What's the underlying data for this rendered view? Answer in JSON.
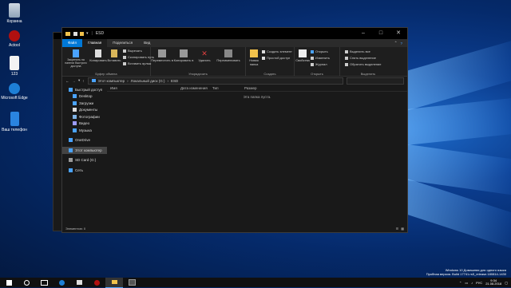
{
  "desktop": {
    "icons": [
      {
        "label": "Корзина"
      },
      {
        "label": "Actool"
      },
      {
        "label": "123"
      },
      {
        "label": "Microsoft Edge"
      },
      {
        "label": "Ваш телефон"
      }
    ]
  },
  "window": {
    "title": "ESD",
    "title_back": "Локальный диск (G:)",
    "tabs": [
      {
        "label": "Файл"
      },
      {
        "label": "Главная"
      },
      {
        "label": "Поделиться"
      },
      {
        "label": "Вид"
      }
    ],
    "ribbon": {
      "pin_label": "Закрепить на панели быстрого доступа",
      "copy_label": "Копировать",
      "paste_label": "Вставить",
      "cut_label": "Вырезать",
      "copy_path_label": "Скопировать путь",
      "paste_shortcut_label": "Вставить ярлык",
      "clipboard_group": "Буфер обмена",
      "move_to_label": "Переместить в",
      "copy_to_label": "Копировать в",
      "delete_label": "Удалить",
      "rename_label": "Переименовать",
      "organize_group": "Упорядочить",
      "new_folder_label": "Новая папка",
      "new_item_label": "Создать элемент",
      "easy_access_label": "Простой доступ",
      "create_group": "Создать",
      "properties_label": "Свойства",
      "open_label": "Открыть",
      "edit_label": "Изменить",
      "history_label": "Журнал",
      "open_group": "Открыть",
      "select_all_label": "Выделить все",
      "select_none_label": "Снять выделение",
      "invert_selection_label": "Обратить выделение",
      "select_group": "Выделить"
    },
    "address": {
      "path": [
        "Этот компьютер",
        "Локальный диск (G:)",
        "ESD"
      ]
    },
    "nav": [
      {
        "label": "Быстрый доступ"
      },
      {
        "label": "Desktop"
      },
      {
        "label": "Загрузки"
      },
      {
        "label": "Документы"
      },
      {
        "label": "Фотографии"
      },
      {
        "label": "Видео"
      },
      {
        "label": "Музыка"
      },
      {
        "label": "OneDrive"
      },
      {
        "label": "Этот компьютер"
      },
      {
        "label": "SD Card (G:)"
      },
      {
        "label": "Сеть"
      }
    ],
    "columns": [
      {
        "label": "Имя"
      },
      {
        "label": "Дата изменения"
      },
      {
        "label": "Тип"
      },
      {
        "label": "Размер"
      }
    ],
    "empty_text": "Эта папка пуста.",
    "status_text": "Элементов: 0"
  },
  "watermark": {
    "line1": "Windows 10 Домашняя для одного языка",
    "line2": "Пробная версия. Build 17741.rs5_release.180814-1430"
  },
  "tray": {
    "lang": "РУС",
    "time": "9:34",
    "date": "21.08.2018"
  },
  "colors": {
    "accent": "#0078d7",
    "folder": "#f0c14b",
    "dark_bg": "#191919"
  }
}
